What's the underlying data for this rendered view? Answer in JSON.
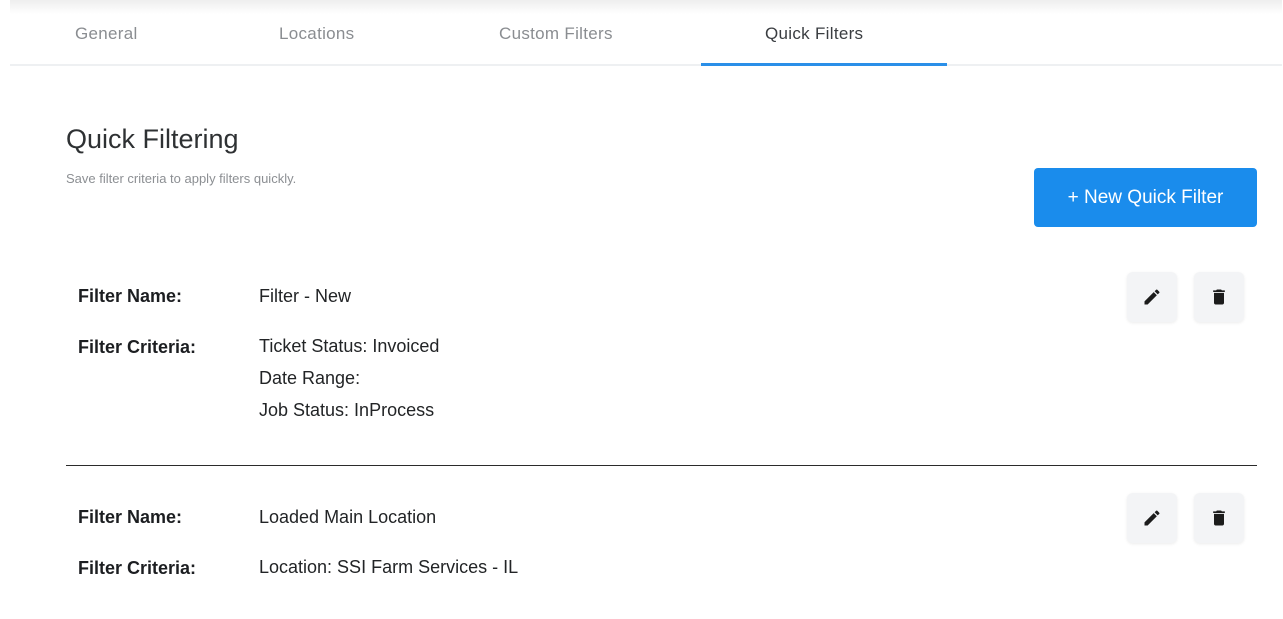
{
  "tabs": [
    {
      "label": "General"
    },
    {
      "label": "Locations"
    },
    {
      "label": "Custom Filters"
    },
    {
      "label": "Quick Filters",
      "active": true
    }
  ],
  "header": {
    "title": "Quick Filtering",
    "subtitle": "Save filter criteria to apply filters quickly.",
    "new_button_label": "+ New Quick Filter"
  },
  "labels": {
    "filter_name": "Filter Name:",
    "filter_criteria": "Filter Criteria:"
  },
  "filters": [
    {
      "name": "Filter - New",
      "criteria": [
        "Ticket Status: Invoiced",
        "Date Range:",
        "Job Status: InProcess"
      ]
    },
    {
      "name": "Loaded Main Location",
      "criteria": [
        "Location: SSI Farm Services - IL"
      ]
    }
  ],
  "colors": {
    "accent": "#1a8cec",
    "tab_underline": "#2a8fe8",
    "icon_button_bg": "#f3f4f6"
  },
  "icons": [
    "edit-pencil-icon",
    "trash-icon"
  ]
}
